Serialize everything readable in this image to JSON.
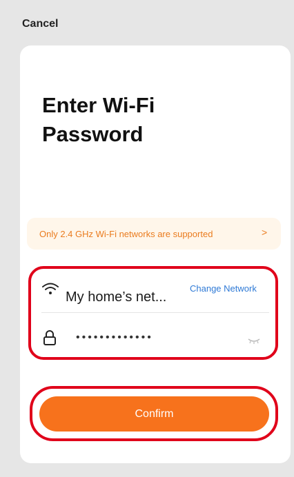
{
  "header": {
    "cancel_label": "Cancel"
  },
  "page": {
    "title_line1": "Enter Wi-Fi",
    "title_line2": "Password"
  },
  "notice": {
    "text": "Only 2.4 GHz Wi-Fi networks are supported",
    "chevron": ">"
  },
  "network": {
    "name": "My home’s net...",
    "change_label": "Change Network",
    "icon": "wifi-icon"
  },
  "password": {
    "masked_value": "•••••••••••••",
    "icon": "lock-icon",
    "toggle_icon": "eye-closed-icon"
  },
  "actions": {
    "confirm_label": "Confirm"
  },
  "colors": {
    "accent": "#f7721c",
    "link": "#2f7ad6",
    "notice_bg": "#fff6ea",
    "highlight": "#e0001a"
  }
}
